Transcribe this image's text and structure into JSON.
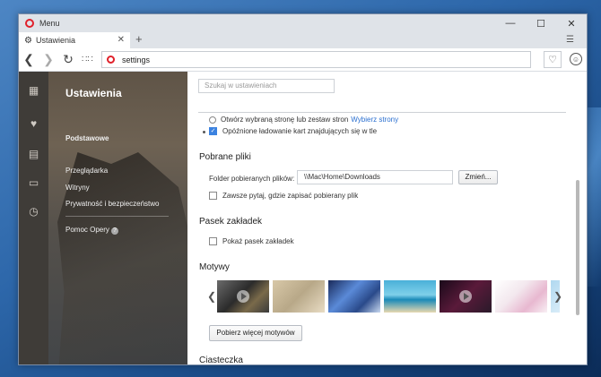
{
  "window": {
    "title": "Menu"
  },
  "tab": {
    "label": "Ustawienia"
  },
  "address": {
    "url": "settings"
  },
  "sidebar": {
    "title": "Ustawienia",
    "items": [
      {
        "label": "Podstawowe"
      },
      {
        "label": "Przeglądarka"
      },
      {
        "label": "Witryny"
      },
      {
        "label": "Prywatność i bezpieczeństwo"
      },
      {
        "label": "Pomoc Opery"
      }
    ]
  },
  "search": {
    "placeholder": "Szukaj w ustawieniach"
  },
  "startup": {
    "option_open": "Otwórz wybraną stronę lub zestaw stron",
    "choose_pages": "Wybierz strony",
    "delayed_loading": "Opóźnione ładowanie kart znajdujących się w tle"
  },
  "downloads": {
    "heading": "Pobrane pliki",
    "folder_label": "Folder pobieranych plików:",
    "folder_value": "\\\\Mac\\Home\\Downloads",
    "change_button": "Zmień...",
    "ask_where": "Zawsze pytaj, gdzie zapisać pobierany plik"
  },
  "bookmarks_bar": {
    "heading": "Pasek zakładek",
    "show_label": "Pokaż pasek zakładek"
  },
  "themes": {
    "heading": "Motywy",
    "get_more": "Pobierz więcej motywów",
    "colors": [
      "#3a3a3a",
      "#d8c8a8",
      "#2a4a8a",
      "#4ab0d8",
      "#2a1a2a",
      "#f3e8ee",
      "#b0d8f0"
    ]
  },
  "cookies": {
    "heading": "Ciasteczka"
  }
}
